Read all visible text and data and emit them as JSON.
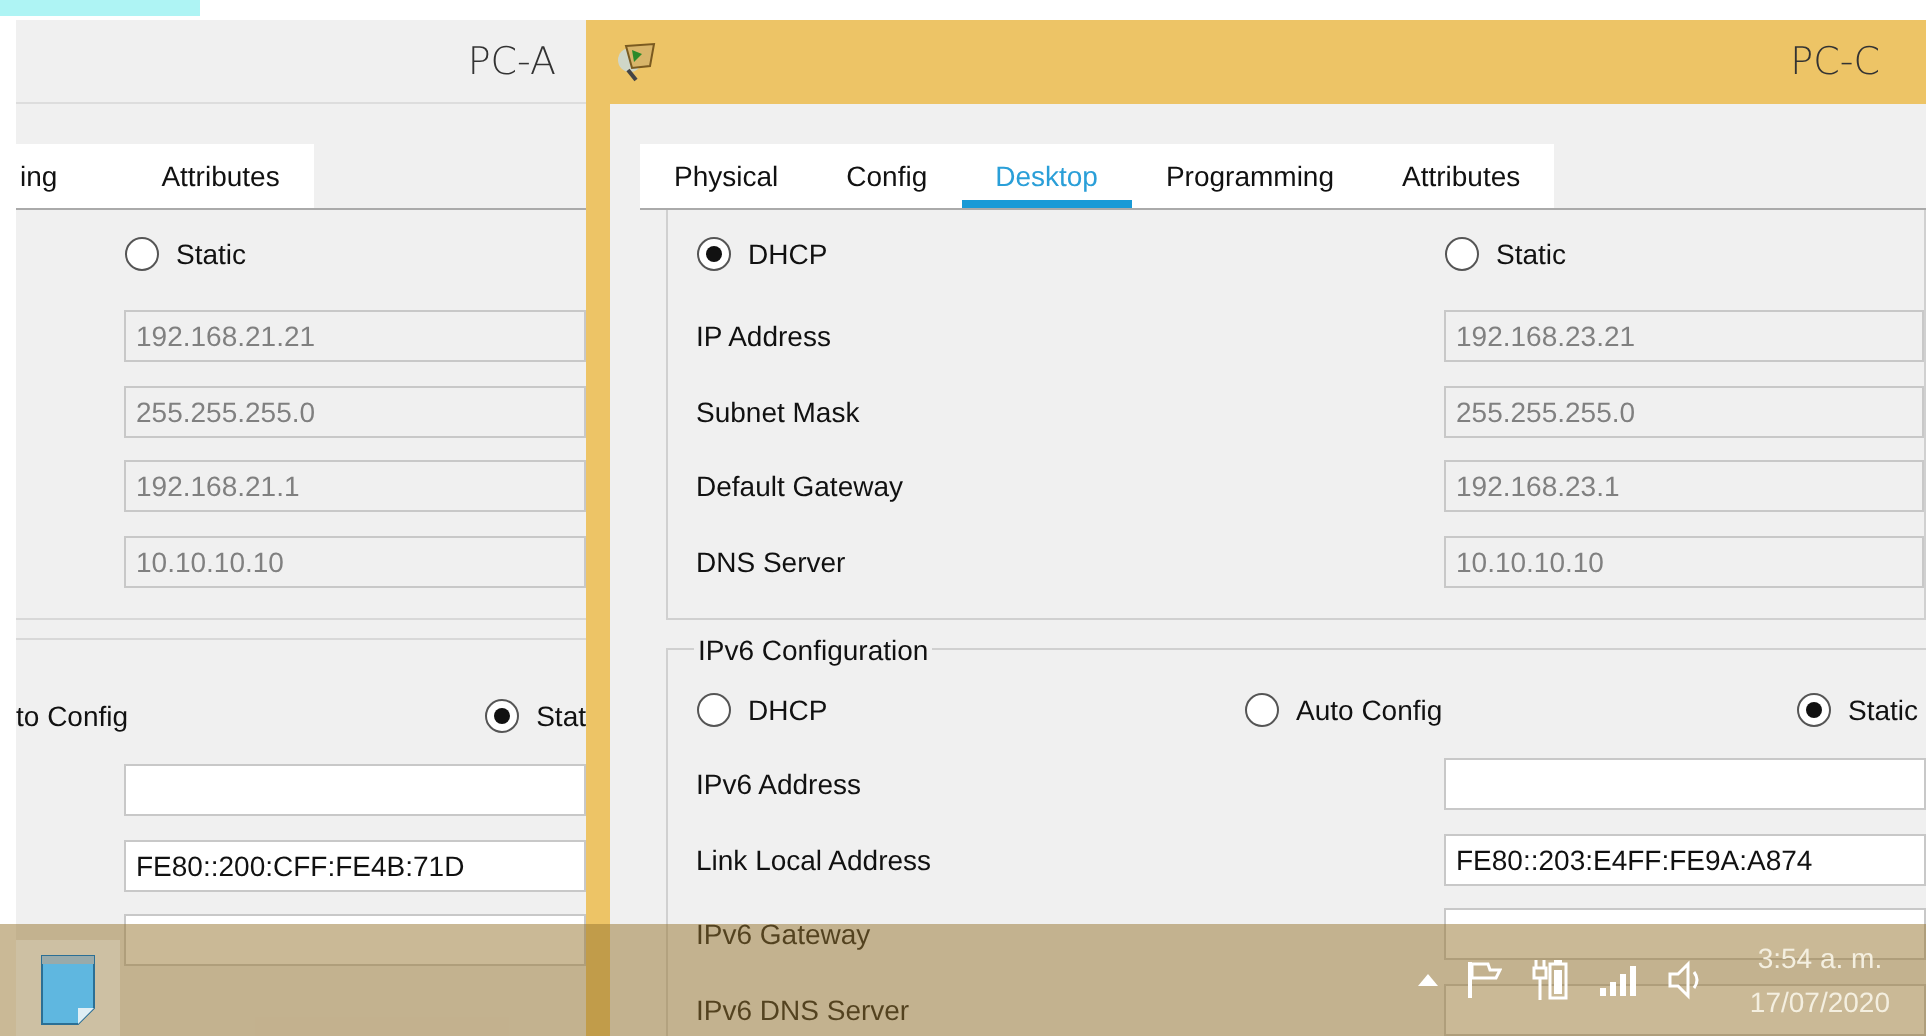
{
  "windows": [
    {
      "title": "PC-A",
      "tabs": [
        {
          "label": "ing",
          "selected": false
        },
        {
          "label": "Attributes",
          "selected": false
        }
      ],
      "ipv4_radios": [
        {
          "label": "Static",
          "selected": false
        }
      ],
      "ipv4_rows": [
        {
          "value": "192.168.21.21",
          "disabled": true
        },
        {
          "value": "255.255.255.0",
          "disabled": true
        },
        {
          "value": "192.168.21.1",
          "disabled": true
        },
        {
          "value": "10.10.10.10",
          "disabled": true
        }
      ],
      "ipv6_radios": [
        {
          "label": "to Config"
        },
        {
          "label": "Stat",
          "selected": true
        }
      ],
      "ipv6_rows": [
        {
          "disabled": false
        },
        {
          "value": "FE80::200:CFF:FE4B:71D",
          "disabled": false
        },
        {
          "disabled": false
        }
      ]
    },
    {
      "title": "PC-C",
      "tabs": [
        {
          "label": "Physical",
          "selected": false
        },
        {
          "label": "Config",
          "selected": false
        },
        {
          "label": "Desktop",
          "selected": true
        },
        {
          "label": "Programming",
          "selected": false
        },
        {
          "label": "Attributes",
          "selected": false
        }
      ],
      "ipv4_radios": [
        {
          "label": "DHCP",
          "selected": true
        },
        {
          "label": "Static",
          "selected": false
        }
      ],
      "ipv4_rows": [
        {
          "label": "IP Address",
          "value": "192.168.23.21",
          "disabled": true
        },
        {
          "label": "Subnet Mask",
          "value": "255.255.255.0",
          "disabled": true
        },
        {
          "label": "Default Gateway",
          "value": "192.168.23.1",
          "disabled": true
        },
        {
          "label": "DNS Server",
          "value": "10.10.10.10",
          "disabled": true
        }
      ],
      "ipv6_legend": "IPv6 Configuration",
      "ipv6_radios": [
        {
          "label": "DHCP",
          "selected": false
        },
        {
          "label": "Auto Config",
          "selected": false
        },
        {
          "label": "Static",
          "selected": true
        }
      ],
      "ipv6_rows": [
        {
          "label": "IPv6 Address",
          "disabled": false
        },
        {
          "label": "Link Local Address",
          "value": "FE80::203:E4FF:FE9A:A874",
          "disabled": false
        },
        {
          "label": "IPv6 Gateway",
          "disabled": false
        },
        {
          "label": "IPv6 DNS Server"
        }
      ]
    }
  ],
  "taskbar": {
    "time": "3:54 a. m.",
    "date": "17/07/2020"
  }
}
